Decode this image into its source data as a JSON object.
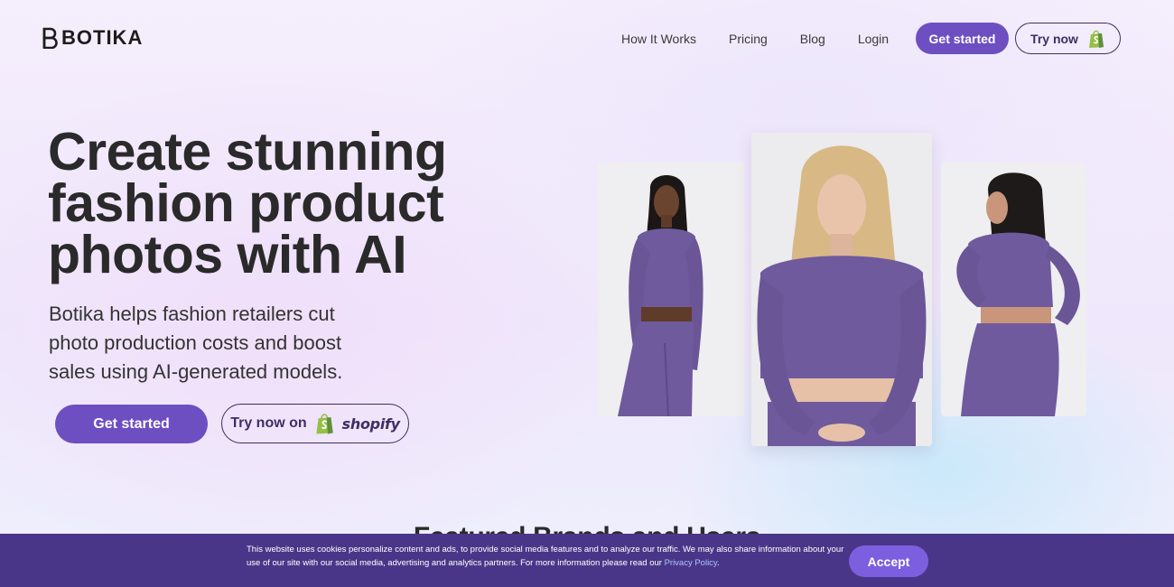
{
  "brand": {
    "name": "BOTIKA",
    "accent": "#6d4fc2",
    "dark": "#3e2f63",
    "banner_bg": "#4a3688"
  },
  "nav": {
    "items": [
      {
        "label": "How It Works"
      },
      {
        "label": "Pricing"
      },
      {
        "label": "Blog"
      },
      {
        "label": "Login"
      }
    ],
    "cta_primary": "Get started",
    "cta_secondary": "Try now"
  },
  "hero": {
    "title": "Create stunning fashion product photos with AI",
    "subtitle": "Botika helps fashion retailers cut photo production costs and boost sales using AI-generated models.",
    "cta_primary": "Get started",
    "cta_secondary": "Try now on",
    "shopify_word": "shopify"
  },
  "gallery": {
    "outfit_color": "#6f5a9e",
    "photos": [
      {
        "icon": "model-photo-front-icon"
      },
      {
        "icon": "model-photo-blonde-icon"
      },
      {
        "icon": "model-photo-back-icon"
      }
    ]
  },
  "next_section": {
    "title": "Featured Brands and Users"
  },
  "cookie": {
    "text": "This website uses cookies personalize content and ads, to provide social media features and to analyze our traffic. We may also share information about your use of our site with our social media, advertising and analytics partners. For more information please read our",
    "link_label": "Privacy Policy",
    "suffix": ".",
    "accept_label": "Accept"
  }
}
